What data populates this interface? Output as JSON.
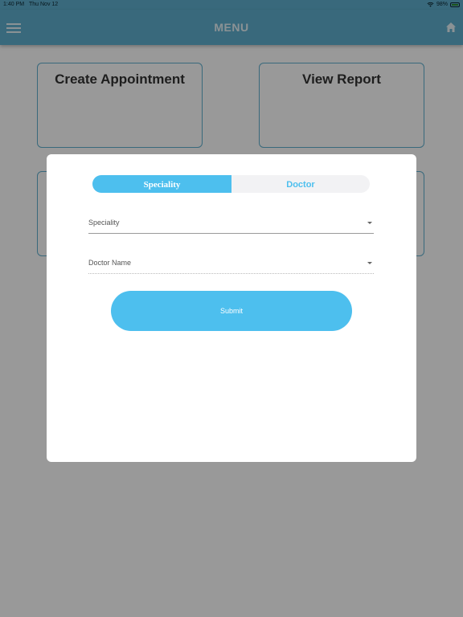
{
  "status_bar": {
    "time": "1:40 PM",
    "date": "Thu Nov 12",
    "battery": "98%"
  },
  "nav": {
    "title": "MENU",
    "left_icon": "hamburger-menu-icon",
    "right_icon": "home-icon"
  },
  "tiles": [
    {
      "label": "Create Appointment"
    },
    {
      "label": "View Report"
    },
    {
      "label": ""
    },
    {
      "label": ""
    }
  ],
  "modal": {
    "tabs": [
      {
        "label": "Speciality",
        "active": true
      },
      {
        "label": "Doctor",
        "active": false
      }
    ],
    "fields": {
      "speciality": {
        "label": "Speciality"
      },
      "doctor_name": {
        "label": "Doctor Name"
      }
    },
    "submit_label": "Submit"
  },
  "colors": {
    "header": "#5fb0cf",
    "accent": "#4dbfee",
    "overlay": "rgba(0,0,0,0.40)"
  }
}
